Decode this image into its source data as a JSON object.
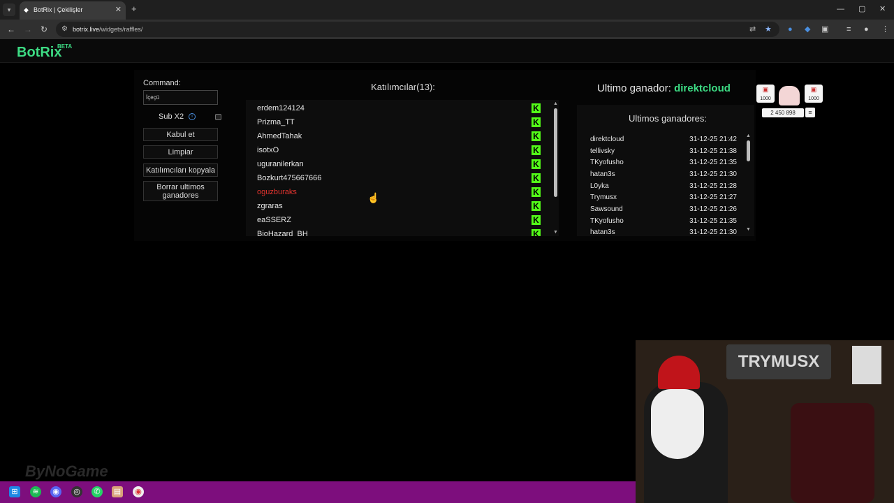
{
  "browser": {
    "tab_title": "BotRix | Çekilişler",
    "tab_close": "✕",
    "new_tab": "+",
    "url_host": "botrix.live",
    "url_path": "/widgets/raffles/",
    "window_controls": [
      "—",
      "▢",
      "✕"
    ]
  },
  "site": {
    "brand": "BotRix",
    "beta": "BETA",
    "brand_color": "#3ddc84"
  },
  "controls": {
    "command_label": "Command:",
    "command_value": "İçeçü",
    "sub_label": "Sub X2",
    "sub_checked": false,
    "buttons": [
      "Kabul et",
      "Limpiar",
      "Katılımcıları kopyala",
      "Borrar ultimos ganadores"
    ]
  },
  "participants": {
    "title": "Katılımcılar(13):",
    "platform_icon": "kick-icon",
    "names": [
      "erdem124124",
      "Prizma_TT",
      "AhmedTahak",
      "isotxO",
      "uguranilerkan",
      "Bozkurt475667666",
      "oguzburaks",
      "zgraras",
      "eaSSERZ",
      "BioHazard_BH"
    ],
    "highlighted": "oguzburaks"
  },
  "winners": {
    "last_label": "Ultimo ganador:",
    "last_name": "direktcloud",
    "list_title": "Ultimos ganadores:",
    "rows": [
      {
        "name": "direktcloud",
        "date": "31-12-25 21:42"
      },
      {
        "name": "tellivsky",
        "date": "31-12-25 21:38"
      },
      {
        "name": "TKyofusho",
        "date": "31-12-25 21:35"
      },
      {
        "name": "hatan3s",
        "date": "31-12-25 21:30"
      },
      {
        "name": "L0yka",
        "date": "31-12-25 21:28"
      },
      {
        "name": "Trymusx",
        "date": "31-12-25 21:27"
      },
      {
        "name": "Sawsound",
        "date": "31-12-25 21:26"
      },
      {
        "name": "TKyofusho",
        "date": "31-12-25 21:35"
      },
      {
        "name": "hatan3s",
        "date": "31-12-25 21:30"
      }
    ]
  },
  "overlay": {
    "left_card_value": "1000",
    "right_card_value": "1000",
    "count": "2 450 898"
  },
  "stream": {
    "watermark": "ByNoGame",
    "webcam_sign": "TRYMUSX"
  }
}
